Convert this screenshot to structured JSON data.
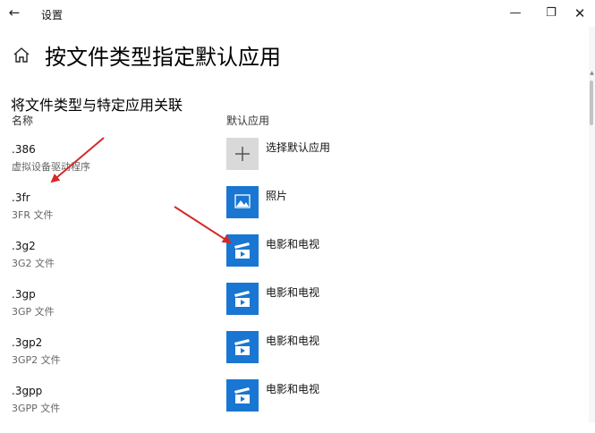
{
  "window": {
    "back_glyph": "←",
    "title": "设置",
    "minimize_glyph": "—",
    "maximize_glyph": "❐",
    "close_glyph": "✕"
  },
  "header": {
    "home_icon": "home-icon",
    "title": "按文件类型指定默认应用"
  },
  "section": {
    "title": "将文件类型与特定应用关联",
    "col_name": "名称",
    "col_app": "默认应用"
  },
  "rows": [
    {
      "ext": ".386",
      "desc": "虚拟设备驱动程序",
      "app": "选择默认应用",
      "icon": "plus-icon"
    },
    {
      "ext": ".3fr",
      "desc": "3FR 文件",
      "app": "照片",
      "icon": "photos-icon"
    },
    {
      "ext": ".3g2",
      "desc": "3G2 文件",
      "app": "电影和电视",
      "icon": "movies-tv-icon"
    },
    {
      "ext": ".3gp",
      "desc": "3GP 文件",
      "app": "电影和电视",
      "icon": "movies-tv-icon"
    },
    {
      "ext": ".3gp2",
      "desc": "3GP2 文件",
      "app": "电影和电视",
      "icon": "movies-tv-icon"
    },
    {
      "ext": ".3gpp",
      "desc": "3GPP 文件",
      "app": "电影和电视",
      "icon": "movies-tv-icon"
    }
  ],
  "colors": {
    "accent": "#1976d2",
    "annotation_arrow": "#d62828"
  }
}
